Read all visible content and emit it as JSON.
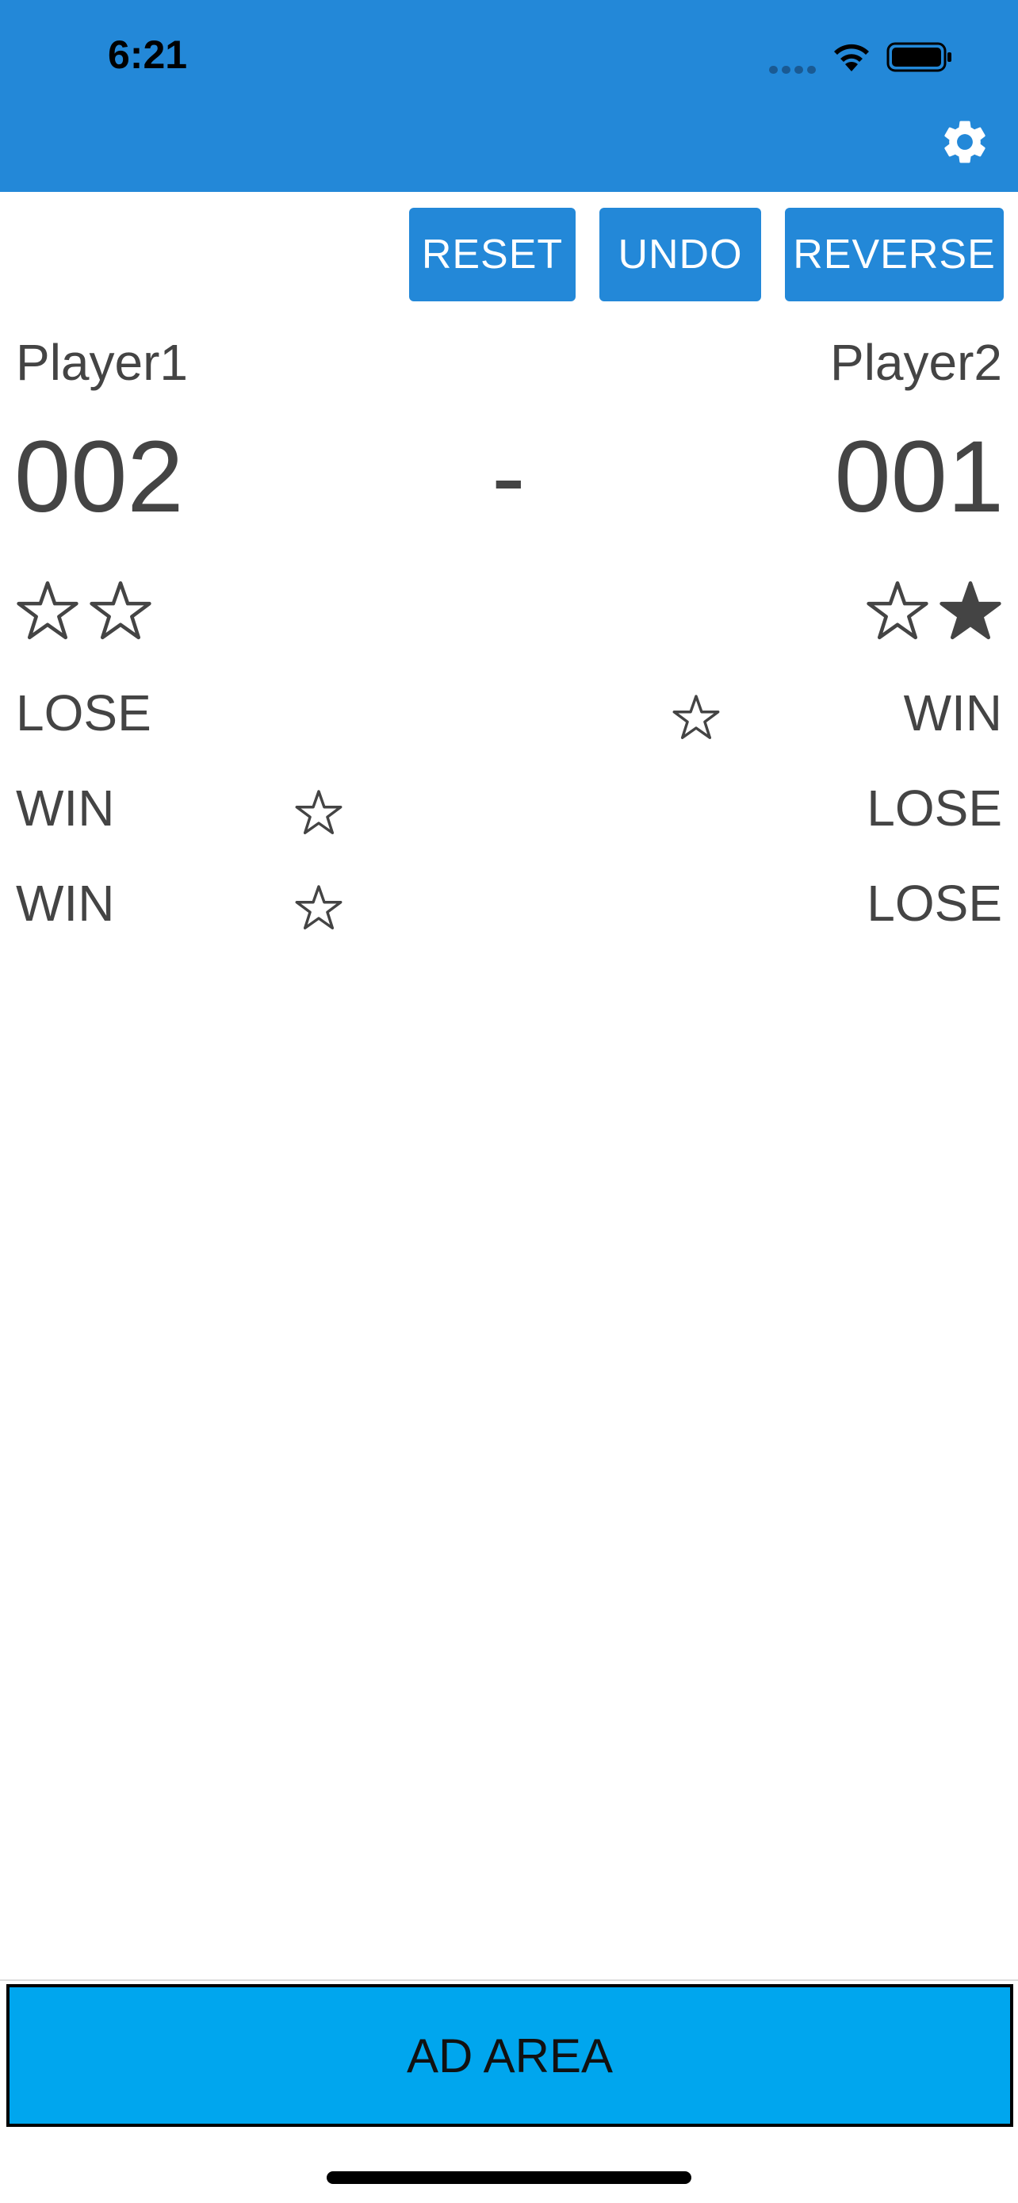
{
  "status_bar": {
    "time": "6:21"
  },
  "toolbar": {
    "reset_label": "RESET",
    "undo_label": "UNDO",
    "reverse_label": "REVERSE"
  },
  "players": [
    {
      "name": "Player1",
      "score": "002",
      "stars": [
        "empty",
        "empty"
      ]
    },
    {
      "name": "Player2",
      "score": "001",
      "stars": [
        "empty",
        "filled"
      ]
    }
  ],
  "score_separator": "-",
  "history": [
    {
      "left": "LOSE",
      "right": "WIN",
      "star_side": "right"
    },
    {
      "left": "WIN",
      "right": "LOSE",
      "star_side": "left"
    },
    {
      "left": "WIN",
      "right": "LOSE",
      "star_side": "left"
    }
  ],
  "ad": {
    "label": "AD AREA"
  },
  "colors": {
    "header": "#2388d8",
    "button": "#2388d8",
    "ad_background": "#00a6ee",
    "text": "#444444"
  },
  "icons": {
    "settings": "gear-icon",
    "star_empty": "star-outline-icon",
    "star_filled": "star-filled-icon"
  }
}
